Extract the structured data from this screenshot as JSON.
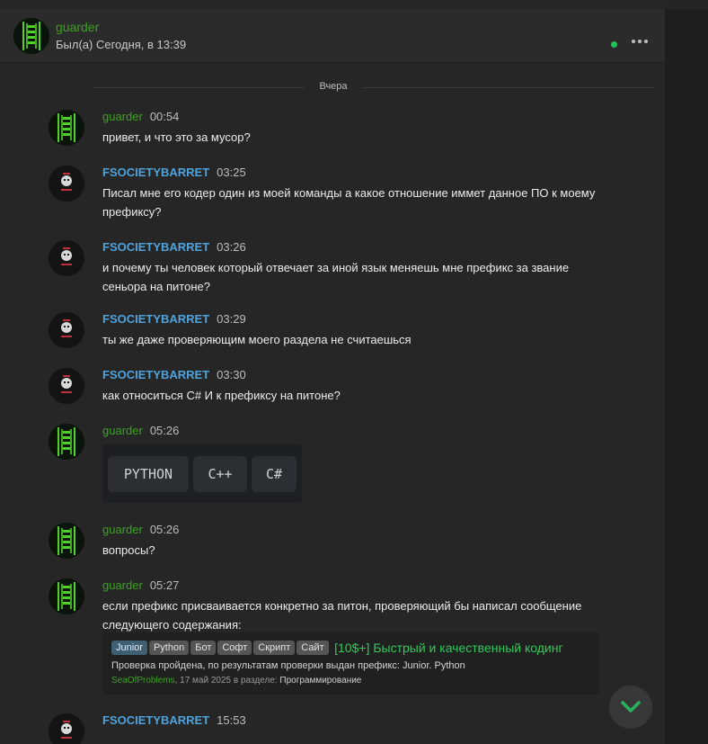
{
  "colors": {
    "background": "#262626",
    "header": "#2b2b2b",
    "green_name": "#3aa31f",
    "blue_name": "#4ea3dc",
    "online": "#21c45a",
    "thread_title": "#30c95b"
  },
  "header": {
    "name": "guarder",
    "status": "Был(а) Сегодня, в 13:39",
    "icons": [
      "online-dot",
      "more-options-icon"
    ]
  },
  "divider": {
    "label": "Вчера"
  },
  "messages": [
    {
      "author": "guarder",
      "time": "00:54",
      "text": "привет, и что это за мусор?"
    },
    {
      "author": "FSOCIETYBARRET",
      "time": "03:25",
      "text": "Писал мне его кодер один из моей команды а какое отношение иммет данное ПО к моему префиксу?"
    },
    {
      "author": "FSOCIETYBARRET",
      "time": "03:26",
      "text": "и почему ты человек который отвечает за иной язык меняешь мне префикс за звание сеньора на питоне?"
    },
    {
      "author": "FSOCIETYBARRET",
      "time": "03:29",
      "text": "ты же даже проверяющим моего раздела не считаешься"
    },
    {
      "author": "FSOCIETYBARRET",
      "time": "03:30",
      "text": "как относиться C# И к префиксу на питоне?"
    },
    {
      "author": "guarder",
      "time": "05:26",
      "image_labels": [
        "PYTHON",
        "C++",
        "C#"
      ]
    },
    {
      "author": "guarder",
      "time": "05:26",
      "text": "вопросы?"
    },
    {
      "author": "guarder",
      "time": "05:27",
      "text": "если префикс присваивается конкретно за питон, проверяющий бы написал сообщение следующего содержания:",
      "quote": {
        "tags": [
          "Junior",
          "Python",
          "Бот",
          "Софт",
          "Скрипт",
          "Сайт"
        ],
        "title": "[10$+] Быстрый и качественный кодинг",
        "description": "Проверка пройдена, по результатам проверки выдан префикс: Junior. Python",
        "user": "SeaOfProblems",
        "date": "17 май 2025",
        "in_section": "в разделе:",
        "section": "Программирование"
      }
    },
    {
      "author": "FSOCIETYBARRET",
      "time": "15:53"
    }
  ]
}
